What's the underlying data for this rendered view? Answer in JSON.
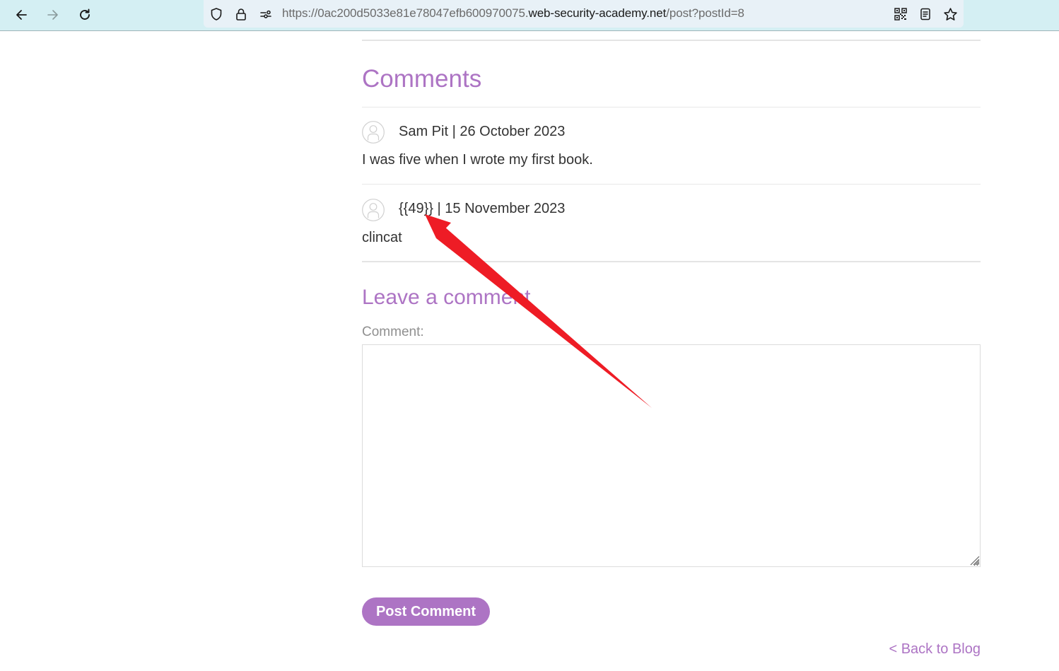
{
  "browser": {
    "url_prefix": "https://0ac200d5033e81e78047efb600970075.",
    "url_host": "web-security-academy.net",
    "url_path": "/post?postId=8",
    "icons": {
      "back": "arrow-left-icon",
      "forward": "arrow-right-icon",
      "reload": "reload-icon",
      "tracking": "shield-icon",
      "security": "lock-icon",
      "permissions": "permissions-icon",
      "qr": "qr-code-icon",
      "reader": "reader-view-icon",
      "bookmark": "star-icon"
    }
  },
  "page": {
    "comments_heading": "Comments",
    "comments": [
      {
        "author": "Sam Pit",
        "separator": "|",
        "date": "26 October 2023",
        "meta": "Sam Pit | 26 October 2023",
        "body": "I was five when I wrote my first book."
      },
      {
        "author": "{{49}}",
        "separator": "|",
        "date": "15 November 2023",
        "meta": "{{49}} | 15 November 2023",
        "body": "clincat"
      }
    ],
    "leave_heading": "Leave a comment",
    "comment_label": "Comment:",
    "comment_value": "",
    "post_button": "Post Comment",
    "back_link": "< Back to Blog"
  },
  "colors": {
    "accent": "#ad74c4",
    "toolbar_bg": "#d4eff3",
    "annotation_arrow": "#ee1c25"
  },
  "annotation": {
    "type": "arrow",
    "points_to": "{{49}}"
  }
}
